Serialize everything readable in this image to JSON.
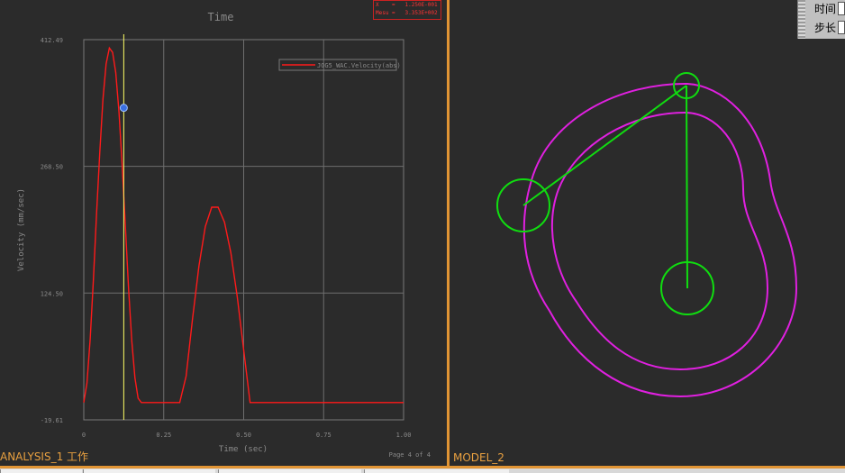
{
  "chart_data": {
    "type": "line",
    "title": "Time",
    "xlabel": "Time (sec)",
    "ylabel": "Velocity (mm/sec)",
    "xlim": [
      0,
      1
    ],
    "ylim": [
      -19.61,
      412.49
    ],
    "x_ticks": [
      "0",
      "0.25",
      "0.50",
      "0.75",
      "1.00"
    ],
    "y_ticks": [
      "412.49",
      "268.50",
      "124.50",
      "-19.61"
    ],
    "series": [
      {
        "name": "JOG5_WAC.Velocity(abs)",
        "color": "#ff1a1a",
        "x": [
          0,
          0.01,
          0.02,
          0.03,
          0.04,
          0.05,
          0.06,
          0.07,
          0.08,
          0.09,
          0.1,
          0.11,
          0.12,
          0.13,
          0.14,
          0.15,
          0.16,
          0.17,
          0.18,
          0.19,
          0.2,
          0.22,
          0.24,
          0.26,
          0.28,
          0.3,
          0.32,
          0.34,
          0.36,
          0.38,
          0.4,
          0.42,
          0.44,
          0.46,
          0.48,
          0.5,
          0.52,
          0.54,
          0.56,
          0.58,
          0.6,
          0.65,
          0.7,
          0.75,
          0.8,
          0.85,
          0.9,
          0.95,
          1.0
        ],
        "y": [
          0,
          22,
          72,
          140,
          215,
          285,
          345,
          385,
          403,
          398,
          375,
          330,
          270,
          200,
          130,
          70,
          28,
          5,
          0,
          0,
          0,
          0,
          0,
          0,
          0,
          0,
          30,
          95,
          155,
          200,
          222,
          222,
          205,
          170,
          120,
          60,
          0,
          0,
          0,
          0,
          0,
          0,
          0,
          0,
          0,
          0,
          0,
          0,
          0
        ]
      }
    ],
    "cursor": {
      "x": 0.125,
      "y": 335
    },
    "grid": true,
    "legend": "top-right",
    "footer": "Page 4 of 4"
  },
  "readout": {
    "line1": "X    =   1.250E-001",
    "line2": "Mesu =   3.353E+002"
  },
  "panes": {
    "analysis_label": "ANALYSIS_1 工作",
    "model_label": "MODEL_2"
  },
  "side_panel": {
    "time_label": "时间",
    "step_label": "步长"
  },
  "colors": {
    "background": "#2b2b2b",
    "pane_border": "#e09434",
    "cam_profile": "#e020e0",
    "mechanism": "#10dd10",
    "curve": "#ff1a1a",
    "cursor": "#ffff66"
  }
}
